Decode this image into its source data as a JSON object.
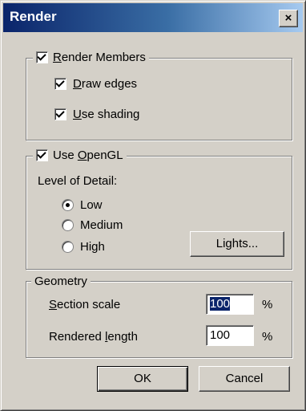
{
  "window": {
    "title": "Render",
    "close_glyph": "×"
  },
  "render_members": {
    "label_pre": "",
    "label_key": "R",
    "label_post": "ender Members",
    "options": [
      {
        "key": "D",
        "rest": "raw edges",
        "checked": true
      },
      {
        "key": "U",
        "rest": "se shading",
        "checked": true
      }
    ]
  },
  "opengl": {
    "label_pre": "Use ",
    "label_key": "O",
    "label_post": "penGL",
    "lod_label": "Level of Detail:",
    "levels": [
      "Low",
      "Medium",
      "High"
    ],
    "selected": "Low",
    "lights_button": "Lights..."
  },
  "geometry": {
    "title": "Geometry",
    "section_scale": {
      "key": "S",
      "rest": "ection scale",
      "value": "100",
      "unit": "%"
    },
    "rendered_length": {
      "pre": "Rendered ",
      "key": "l",
      "rest": "ength",
      "value": "100",
      "unit": "%"
    }
  },
  "buttons": {
    "ok": "OK",
    "cancel": "Cancel"
  }
}
